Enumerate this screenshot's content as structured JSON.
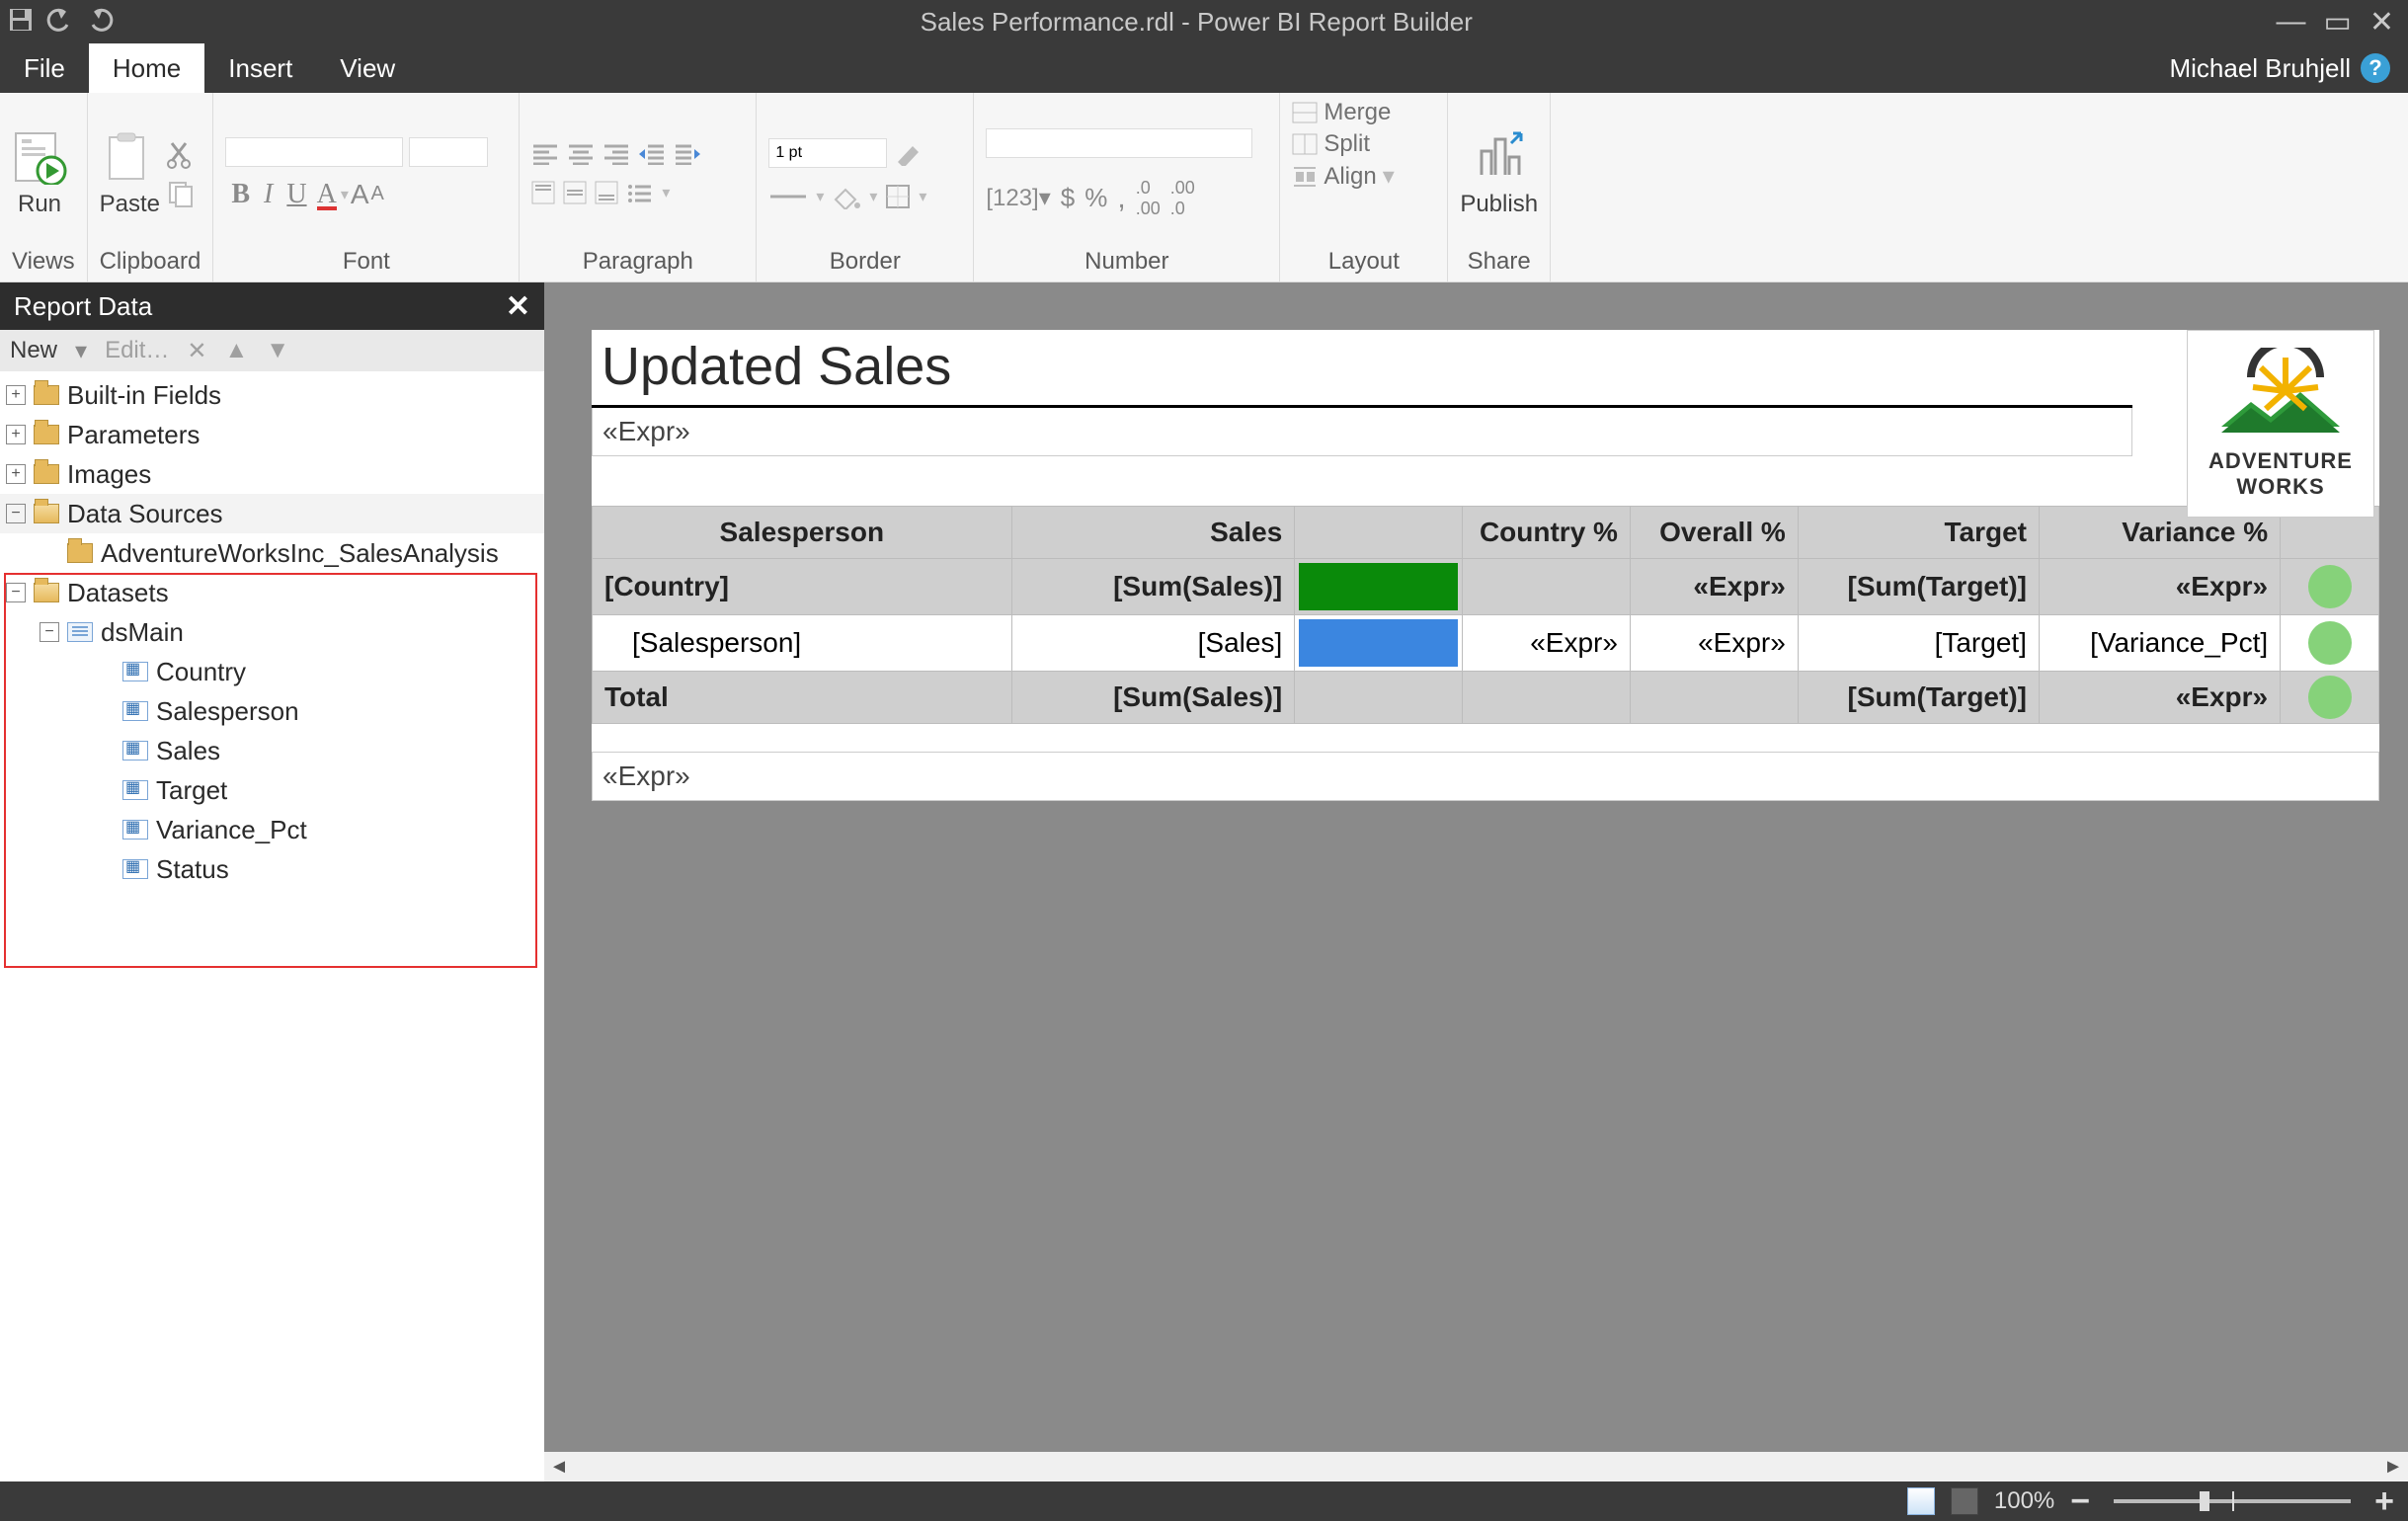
{
  "title": "Sales Performance.rdl - Power BI Report Builder",
  "user": "Michael Bruhjell",
  "tabs": {
    "file": "File",
    "home": "Home",
    "insert": "Insert",
    "view": "View"
  },
  "ribbon": {
    "views": "Views",
    "run": "Run",
    "clipboard": "Clipboard",
    "paste": "Paste",
    "font": "Font",
    "paragraph": "Paragraph",
    "border": "Border",
    "border_pt": "1 pt",
    "number": "Number",
    "layout": "Layout",
    "merge": "Merge",
    "split": "Split",
    "align": "Align",
    "share": "Share",
    "publish": "Publish"
  },
  "panel": {
    "title": "Report Data",
    "new": "New",
    "edit": "Edit…",
    "nodes": {
      "builtin": "Built-in Fields",
      "parameters": "Parameters",
      "images": "Images",
      "datasources": "Data Sources",
      "ds_item": "AdventureWorksInc_SalesAnalysis",
      "datasets": "Datasets",
      "dsmain": "dsMain",
      "fields": [
        "Country",
        "Salesperson",
        "Sales",
        "Target",
        "Variance_Pct",
        "Status"
      ]
    }
  },
  "report": {
    "title": "Updated Sales",
    "expr": "«Expr»",
    "logo": {
      "line1": "ADVENTURE",
      "line2": "WORKS"
    },
    "cols": {
      "salesperson": "Salesperson",
      "sales": "Sales",
      "bar": "",
      "country_pct": "Country %",
      "overall_pct": "Overall %",
      "target": "Target",
      "variance": "Variance %"
    },
    "row_country": {
      "c1": "[Country]",
      "c2": "[Sum(Sales)]",
      "c5": "«Expr»",
      "c6": "[Sum(Target)]",
      "c7": "«Expr»",
      "bar_color": "#0a8a0a"
    },
    "row_sp": {
      "c1": "[Salesperson]",
      "c2": "[Sales]",
      "c4": "«Expr»",
      "c5": "«Expr»",
      "c6": "[Target]",
      "c7": "[Variance_Pct]",
      "bar_color": "#3b86e0"
    },
    "row_total": {
      "c1": "Total",
      "c2": "[Sum(Sales)]",
      "c6": "[Sum(Target)]",
      "c7": "«Expr»"
    },
    "footer": "«Expr»"
  },
  "status": {
    "zoom": "100%"
  }
}
